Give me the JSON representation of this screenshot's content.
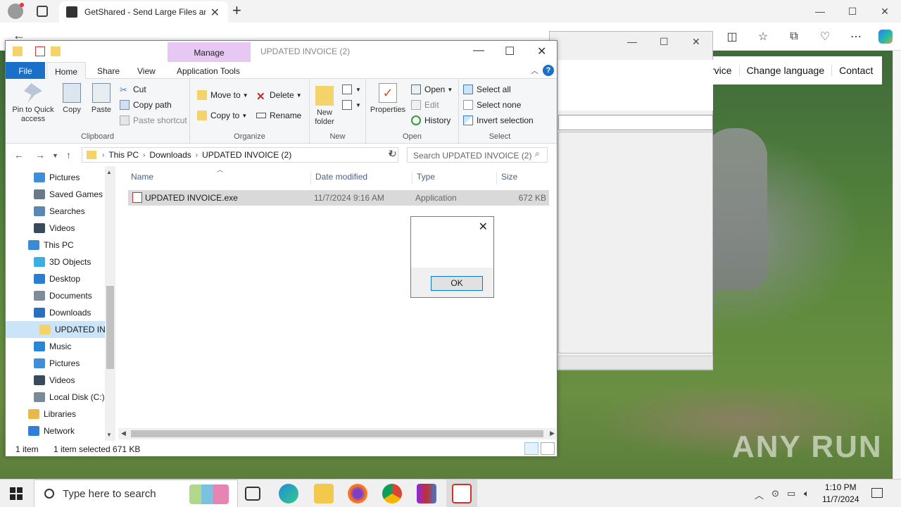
{
  "browser": {
    "tab_title": "GetShared - Send Large Files and",
    "new_tab": "+",
    "min": "—",
    "max": "☐",
    "close": "✕"
  },
  "website": {
    "nav": [
      "rvice",
      "Change language",
      "Contact"
    ]
  },
  "explorer": {
    "manage_tab": "Manage",
    "title": "UPDATED INVOICE (2)",
    "tabs": {
      "file": "File",
      "home": "Home",
      "share": "Share",
      "view": "View",
      "app_tools": "Application Tools"
    },
    "clipboard": {
      "label": "Clipboard",
      "pin": "Pin to Quick access",
      "copy": "Copy",
      "paste": "Paste",
      "cut": "Cut",
      "copy_path": "Copy path",
      "paste_shortcut": "Paste shortcut"
    },
    "organize": {
      "label": "Organize",
      "move_to": "Move to",
      "copy_to": "Copy to",
      "delete": "Delete",
      "rename": "Rename"
    },
    "new": {
      "label": "New",
      "new_folder": "New folder"
    },
    "open": {
      "label": "Open",
      "properties": "Properties",
      "open": "Open",
      "edit": "Edit",
      "history": "History"
    },
    "select": {
      "label": "Select",
      "select_all": "Select all",
      "select_none": "Select none",
      "invert": "Invert selection"
    },
    "address": {
      "crumbs": [
        "This PC",
        "Downloads",
        "UPDATED INVOICE (2)"
      ]
    },
    "search_placeholder": "Search UPDATED INVOICE (2)",
    "nav_items": [
      {
        "label": "Pictures",
        "color": "#3f8fd8"
      },
      {
        "label": "Saved Games",
        "color": "#6a7a8a"
      },
      {
        "label": "Searches",
        "color": "#5a88b5"
      },
      {
        "label": "Videos",
        "color": "#3a4a5a"
      },
      {
        "label": "This PC",
        "color": "#3a8ad6"
      },
      {
        "label": "3D Objects",
        "color": "#3ab0e0"
      },
      {
        "label": "Desktop",
        "color": "#2b7dd4"
      },
      {
        "label": "Documents",
        "color": "#7f8c99"
      },
      {
        "label": "Downloads",
        "color": "#2a6fc4"
      },
      {
        "label": "UPDATED INV",
        "color": "#f5d36b"
      },
      {
        "label": "Music",
        "color": "#2a86d6"
      },
      {
        "label": "Pictures",
        "color": "#3f8fd8"
      },
      {
        "label": "Videos",
        "color": "#3a4a5a"
      },
      {
        "label": "Local Disk (C:)",
        "color": "#7a8a99"
      },
      {
        "label": "Libraries",
        "color": "#e8b94a"
      },
      {
        "label": "Network",
        "color": "#2f7ed8"
      }
    ],
    "columns": {
      "name": "Name",
      "date": "Date modified",
      "type": "Type",
      "size": "Size"
    },
    "file": {
      "name": "UPDATED INVOICE.exe",
      "date": "11/7/2024 9:16 AM",
      "type": "Application",
      "size": "672 KB"
    },
    "status": {
      "count": "1 item",
      "selected": "1 item selected  671 KB"
    }
  },
  "msgbox": {
    "close": "✕",
    "ok": "OK"
  },
  "taskbar": {
    "search_placeholder": "Type here to search",
    "time": "1:10 PM",
    "date": "11/7/2024"
  },
  "watermark": "ANY RUN"
}
